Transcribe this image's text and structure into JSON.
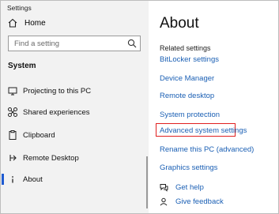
{
  "window": {
    "title": "Settings"
  },
  "sidebar": {
    "home_label": "Home",
    "search": {
      "placeholder": "Find a setting"
    },
    "section_label": "System",
    "items": [
      {
        "label": "Projecting to this PC",
        "icon": "projector-icon",
        "active": false
      },
      {
        "label": "Shared experiences",
        "icon": "shared-experiences-icon",
        "active": false
      },
      {
        "label": "Clipboard",
        "icon": "clipboard-icon",
        "active": false
      },
      {
        "label": "Remote Desktop",
        "icon": "remote-desktop-icon",
        "active": false
      },
      {
        "label": "About",
        "icon": "info-icon",
        "active": true
      }
    ]
  },
  "main": {
    "title": "About",
    "related_settings_label": "Related settings",
    "links": [
      "BitLocker settings",
      "Device Manager",
      "Remote desktop",
      "System protection",
      "Advanced system settings",
      "Rename this PC (advanced)",
      "Graphics settings"
    ],
    "highlighted_link": "Advanced system settings",
    "help": [
      {
        "label": "Get help",
        "icon": "help-chat-icon"
      },
      {
        "label": "Give feedback",
        "icon": "feedback-icon"
      }
    ]
  },
  "colors": {
    "accent": "#1a5fb4",
    "highlight_border": "#e02020",
    "active_indicator": "#1f5bd1",
    "sidebar_bg": "#f2f2f2"
  }
}
